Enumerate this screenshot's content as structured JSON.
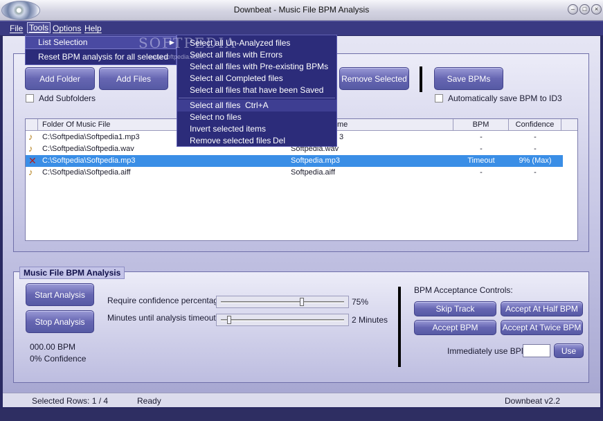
{
  "window": {
    "title": "Downbeat  -  Music File BPM Analysis",
    "controls": [
      "minimize",
      "maximize",
      "close"
    ]
  },
  "menubar": {
    "items": [
      {
        "label": "File"
      },
      {
        "label": "Tools"
      },
      {
        "label": "Options"
      },
      {
        "label": "Help"
      }
    ]
  },
  "tools_menu": {
    "items": [
      {
        "label": "List Selection",
        "has_submenu": true
      },
      {
        "label": "Reset BPM analysis for all selected"
      }
    ]
  },
  "list_selection_submenu": {
    "items": [
      {
        "label": "Select all Un-Analyzed files",
        "shortcut": ""
      },
      {
        "label": "Select all files with Errors",
        "shortcut": ""
      },
      {
        "label": "Select all files with Pre-existing BPMs",
        "shortcut": ""
      },
      {
        "label": "Select all Completed files",
        "shortcut": ""
      },
      {
        "label": "Select all files that have been Saved",
        "shortcut": ""
      },
      {
        "label": "Select all files",
        "shortcut": "Ctrl+A"
      },
      {
        "label": "Select no files",
        "shortcut": ""
      },
      {
        "label": "Invert selected items",
        "shortcut": ""
      },
      {
        "label": "Remove selected files",
        "shortcut": "Del"
      }
    ]
  },
  "watermark": {
    "text": "SOFTPEDIA",
    "url": "www.softpedia.com"
  },
  "files_panel": {
    "add_folder_label": "Add Folder",
    "add_files_label": "Add Files",
    "remove_selected_label": "Remove Selected",
    "save_bpms_label": "Save BPMs",
    "add_subfolders_label": "Add Subfolders",
    "auto_save_label": "Automatically save BPM to ID3",
    "columns": [
      "Folder Of Music File",
      "me",
      "BPM",
      "Confidence"
    ],
    "rows": [
      {
        "path": "C:\\Softpedia\\Softpedia1.mp3",
        "name": "3",
        "bpm": "-",
        "confidence": "-",
        "icon": "music-note-icon",
        "selected": false
      },
      {
        "path": "C:\\Softpedia\\Softpedia.wav",
        "name": "Softpedia.wav",
        "bpm": "-",
        "confidence": "-",
        "icon": "music-note-icon",
        "selected": false
      },
      {
        "path": "C:\\Softpedia\\Softpedia.mp3",
        "name": "Softpedia.mp3",
        "bpm": "Timeout",
        "confidence": "9% (Max)",
        "icon": "error-x-icon",
        "selected": true
      },
      {
        "path": "C:\\Softpedia\\Softpedia.aiff",
        "name": "Softpedia.aiff",
        "bpm": "-",
        "confidence": "-",
        "icon": "music-note-icon",
        "selected": false
      }
    ]
  },
  "analysis_panel": {
    "title": "Music File BPM Analysis",
    "start_label": "Start Analysis",
    "stop_label": "Stop Analysis",
    "bpm_readout": "000.00 BPM",
    "confidence_readout": "0% Confidence",
    "confidence_slider": {
      "label": "Require confidence percentage:",
      "value_text": "75%",
      "fraction": 0.66
    },
    "timeout_slider": {
      "label": "Minutes until analysis timeout:",
      "value_text": "2 Minutes",
      "fraction": 0.05
    },
    "acceptance_title": "BPM Acceptance Controls:",
    "skip_label": "Skip Track",
    "accept_half_label": "Accept At Half BPM",
    "accept_label": "Accept BPM",
    "accept_twice_label": "Accept At Twice BPM",
    "immediate_label": "Immediately use BPM:",
    "immediate_value": "",
    "use_label": "Use"
  },
  "statusbar": {
    "selected_rows": "Selected Rows:  1 / 4",
    "status": "Ready",
    "version": "Downbeat v2.2"
  },
  "colors": {
    "menu_bg": "#2c2c7a",
    "selection": "#3a8ee6",
    "button": "#6666b2"
  }
}
